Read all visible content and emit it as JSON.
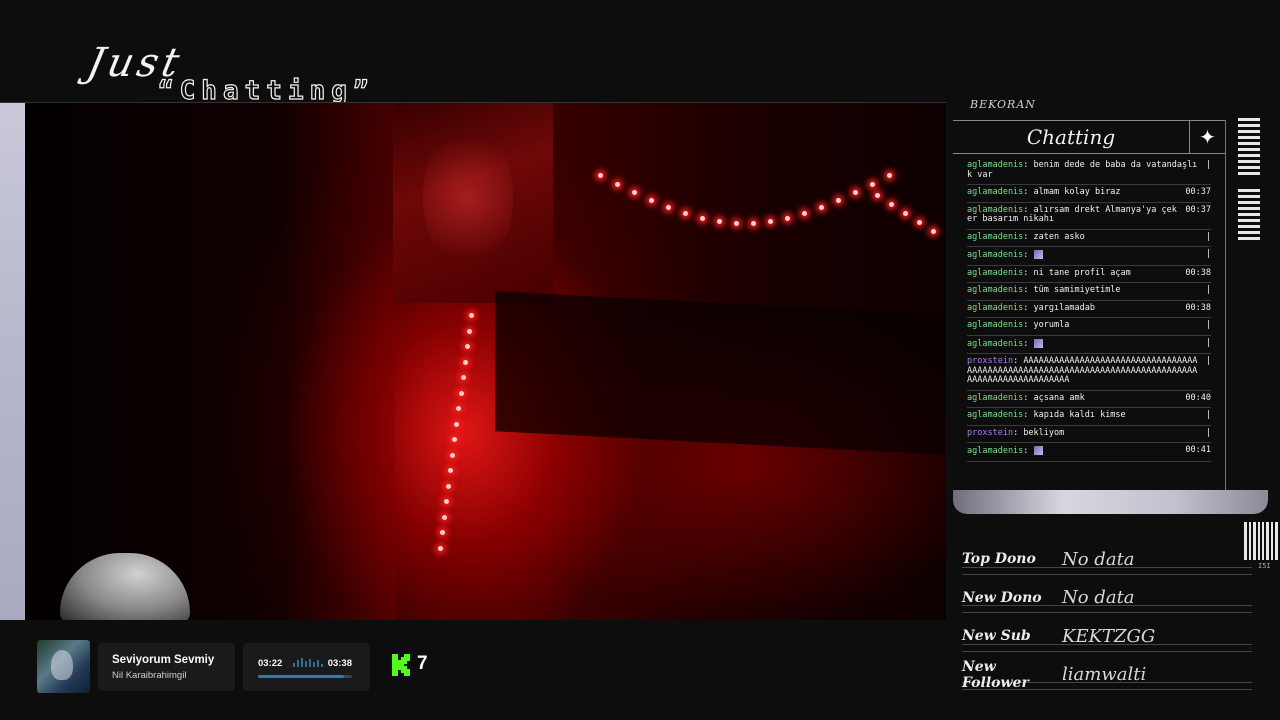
{
  "header": {
    "title_line1": "Just",
    "title_line2": "“Chatting”"
  },
  "chat": {
    "brand": "BEKORAN",
    "title": "Chatting",
    "sparkle_icon": "sparkle-icon",
    "messages": [
      {
        "user": "aglamadenis",
        "text": "benim dede de baba da vatandaşlık var",
        "time": "|",
        "color": "#7ddc8c"
      },
      {
        "user": "aglamadenis",
        "text": "almam kolay biraz",
        "time": "00:37",
        "color": "#7ddc8c"
      },
      {
        "user": "aglamadenis",
        "text": "alırsam drekt Almanya'ya çeker basarım nikahı",
        "time": "00:37",
        "color": "#7ddc8c"
      },
      {
        "user": "aglamadenis",
        "text": "zaten asko",
        "time": "|",
        "color": "#7ddc8c"
      },
      {
        "user": "aglamadenis",
        "text": "",
        "emote": true,
        "time": "|",
        "color": "#7ddc8c"
      },
      {
        "user": "aglamadenis",
        "text": "ni tane profil açam",
        "time": "00:38",
        "color": "#7ddc8c"
      },
      {
        "user": "aglamadenis",
        "text": "tüm samimiyetimle",
        "time": "|",
        "color": "#7ddc8c"
      },
      {
        "user": "aglamadenis",
        "text": "yargılamadab",
        "time": "00:38",
        "color": "#7ddc8c"
      },
      {
        "user": "aglamadenis",
        "text": "yorumla",
        "time": "|",
        "color": "#7ddc8c"
      },
      {
        "user": "aglamadenis",
        "text": "",
        "emote": true,
        "time": "|",
        "color": "#7ddc8c"
      },
      {
        "user": "proxstein",
        "text": "AAAAAAAAAAAAAAAAAAAAAAAAAAAAAAAAAAAAAAAAAAAAAAAAAAAAAAAAAAAAAAAAAAAAAAAAAAAAAAAAAAAAAAAAAAAAAAAAAAA",
        "time": "|",
        "color": "#b07af0"
      },
      {
        "user": "aglamadenis",
        "text": "açsana amk",
        "time": "00:40",
        "color": "#7ddc8c"
      },
      {
        "user": "aglamadenis",
        "text": "kapıda kaldı kimse",
        "time": "|",
        "color": "#7ddc8c"
      },
      {
        "user": "proxstein",
        "text": "bekliyom",
        "time": "|",
        "color": "#b07af0"
      },
      {
        "user": "aglamadenis",
        "text": "",
        "emote": true,
        "time": "00:41",
        "color": "#7ddc8c"
      }
    ]
  },
  "events": [
    {
      "label": "Top Dono",
      "value": "No data"
    },
    {
      "label": "New Dono",
      "value": "No data"
    },
    {
      "label": "New Sub",
      "value": "KEKTZGG"
    },
    {
      "label": "New Follower",
      "value": "liamwalti"
    }
  ],
  "barcode_text": "I5I",
  "music": {
    "album_icon": "album-art",
    "title": "Seviyorum Sevmiy",
    "artist": "Nil Karaibrahimgil",
    "current_time": "03:22",
    "total_time": "03:38",
    "progress_fraction": 0.92,
    "accent_color": "#2a7fb0"
  },
  "kick": {
    "icon": "kick-logo-icon",
    "count": "7",
    "color": "#53fc18"
  }
}
